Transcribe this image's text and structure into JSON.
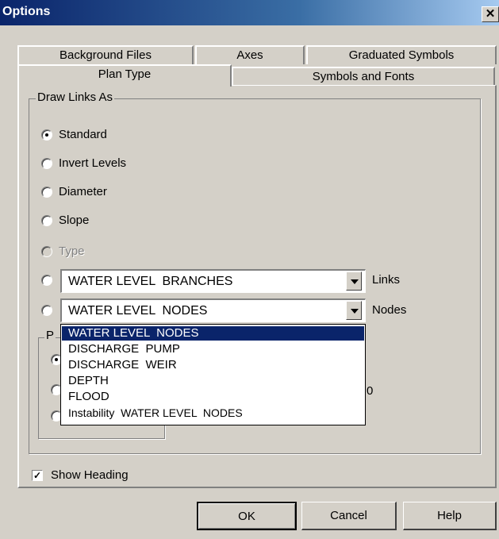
{
  "window": {
    "title": "Options",
    "close_glyph": "✕"
  },
  "tabs_back": [
    "Background Files",
    "Axes",
    "Graduated Symbols"
  ],
  "tabs_front": [
    {
      "label": "Plan Type",
      "active": true
    },
    {
      "label": "Symbols and Fonts",
      "active": false
    }
  ],
  "draw_links": {
    "legend": "Draw Links As",
    "options": [
      {
        "label": "Standard",
        "checked": true,
        "disabled": false
      },
      {
        "label": "Invert Levels",
        "checked": false,
        "disabled": false
      },
      {
        "label": "Diameter",
        "checked": false,
        "disabled": false
      },
      {
        "label": "Slope",
        "checked": false,
        "disabled": false
      },
      {
        "label": "Type",
        "checked": false,
        "disabled": true
      }
    ],
    "links_combo": {
      "value": "WATER LEVEL  BRANCHES",
      "label": "Links"
    },
    "nodes_combo": {
      "value": "WATER LEVEL  NODES",
      "label": "Nodes"
    }
  },
  "subgroup": {
    "legend_partial": "P",
    "trailing_char": "0"
  },
  "dropdown": {
    "options": [
      {
        "label": "WATER LEVEL  NODES",
        "selected": true
      },
      {
        "label": "DISCHARGE  PUMP",
        "selected": false
      },
      {
        "label": "DISCHARGE  WEIR",
        "selected": false
      },
      {
        "label": "DEPTH",
        "selected": false
      },
      {
        "label": "FLOOD",
        "selected": false
      },
      {
        "label": "Instability  WATER LEVEL  NODES",
        "selected": false
      }
    ]
  },
  "show_heading": {
    "label": "Show Heading",
    "checked": true,
    "check_glyph": "✓"
  },
  "buttons": {
    "ok": "OK",
    "cancel": "Cancel",
    "help": "Help"
  }
}
